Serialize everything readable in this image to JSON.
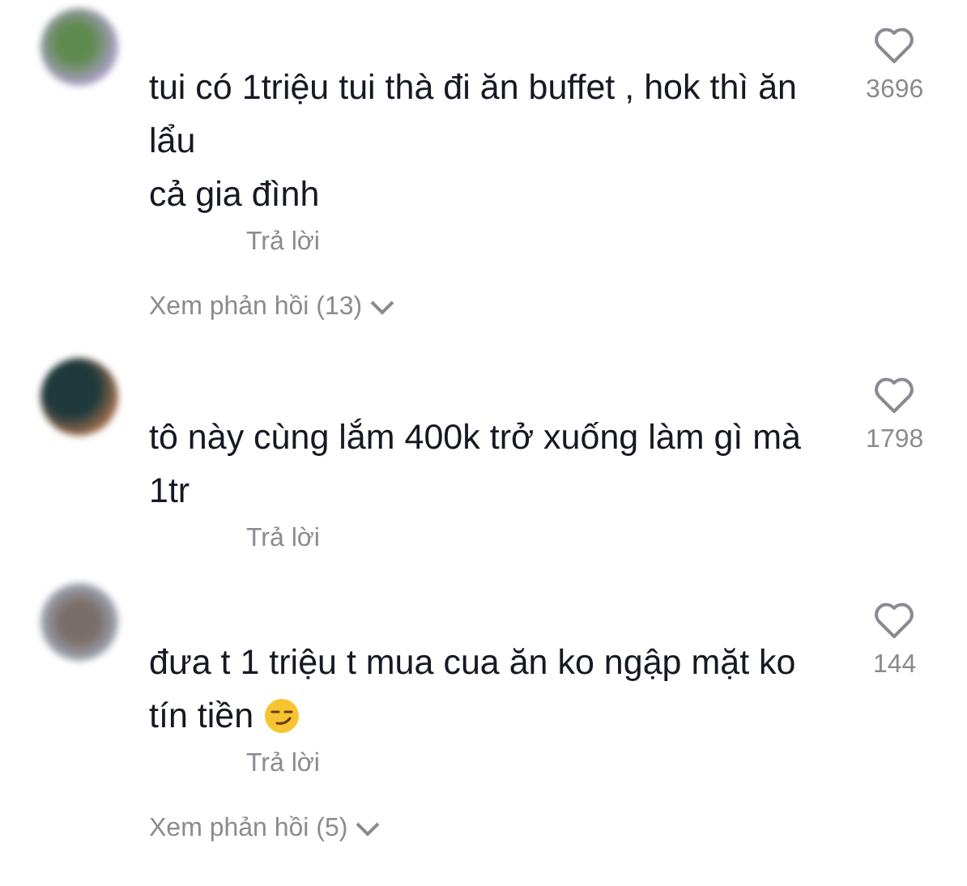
{
  "comments": [
    {
      "text": "tui có 1triệu tui thà đi ăn buffet , hok thì ăn lẩu\ncả gia đình",
      "emoji": false,
      "likes": "3696",
      "liked": false,
      "reply": "Trả lời",
      "view_replies": "Xem phản hồi (13)"
    },
    {
      "text": "tô này cùng lắm 400k trở xuống làm gì mà 1tr",
      "emoji": false,
      "likes": "1798",
      "liked": false,
      "reply": "Trả lời"
    },
    {
      "text": "đưa t 1 triệu t mua cua ăn ko ngập mặt ko tín tiền",
      "emoji": true,
      "likes": "144",
      "liked": false,
      "reply": "Trả lời",
      "view_replies": "Xem phản hồi (5)"
    }
  ]
}
